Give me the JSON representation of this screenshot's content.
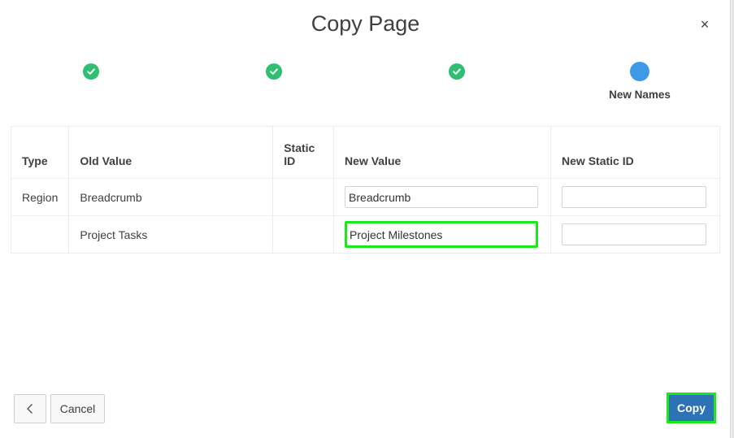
{
  "dialog": {
    "title": "Copy Page",
    "close_label": "×"
  },
  "wizard": {
    "steps": [
      {
        "state": "completed",
        "label": ""
      },
      {
        "state": "completed",
        "label": ""
      },
      {
        "state": "completed",
        "label": ""
      },
      {
        "state": "current",
        "label": "New Names"
      }
    ]
  },
  "table": {
    "headers": {
      "type": "Type",
      "old_value": "Old Value",
      "static_id_line1": "Static",
      "static_id_line2": "ID",
      "new_value": "New Value",
      "new_static_id": "New Static ID"
    },
    "rows": [
      {
        "type": "Region",
        "old_value": "Breadcrumb",
        "static_id": "",
        "new_value": "Breadcrumb",
        "new_static_id": ""
      },
      {
        "type": "",
        "old_value": "Project Tasks",
        "static_id": "",
        "new_value": "Project Milestones",
        "new_static_id": ""
      }
    ]
  },
  "footer": {
    "back_icon": "chevron-left-icon",
    "cancel_label": "Cancel",
    "copy_label": "Copy"
  },
  "colors": {
    "step_completed": "#2ebf70",
    "step_current": "#3d9ae8",
    "primary_button": "#2c72b6",
    "highlight": "#1be81b"
  }
}
